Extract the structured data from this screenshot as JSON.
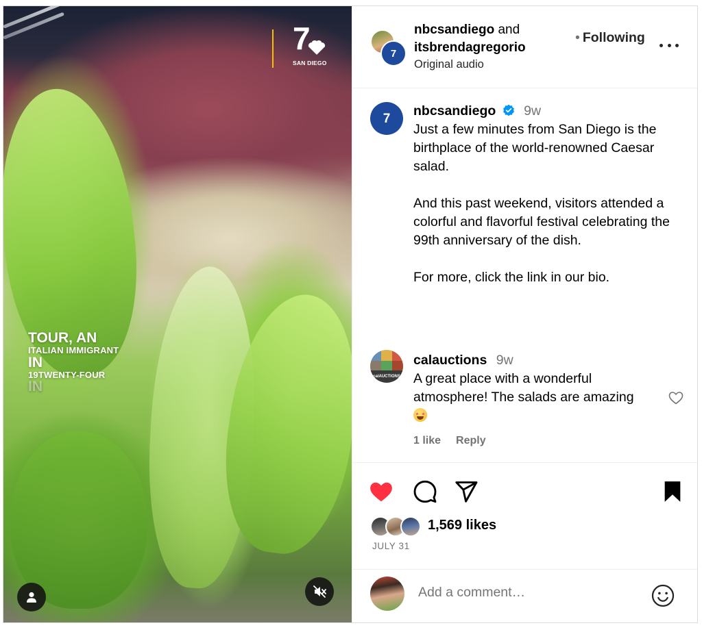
{
  "media": {
    "overlay_lines": [
      {
        "text": "TOUR, AN",
        "size": "big"
      },
      {
        "text": "ITALIAN IMMIGRANT",
        "size": "small"
      },
      {
        "text": "IN",
        "size": "big"
      },
      {
        "text": "19TWENTY-FOUR",
        "size": "small"
      },
      {
        "text": "IN",
        "size": "big",
        "faded": true
      }
    ],
    "logo_number": "7",
    "logo_city": "SAN DIEGO",
    "tag_icon": "person-icon",
    "mute_icon": "muted-speaker-icon"
  },
  "header": {
    "owner1": "nbcsandiego",
    "joiner": " and ",
    "owner2": "itsbrendagregorio",
    "audio": "Original audio",
    "follow_label": "Following",
    "more_icon": "more-options-icon"
  },
  "caption": {
    "user": "nbcsandiego",
    "time": "9w",
    "paragraphs": [
      "Just a few minutes from San Diego is the birthplace of the world-renowned Caesar salad.",
      "And this past weekend, visitors attended a colorful and flavorful festival celebrating the 99th anniversary of the dish.",
      "For more, click the link in our bio."
    ]
  },
  "comment": {
    "user": "calauctions",
    "time": "9w",
    "text": "A great place with a wonderful atmosphere! The salads are amazing",
    "emoji": "star-struck",
    "likes": "1 like",
    "reply_label": "Reply",
    "avatar_text": "calAUCTIONS"
  },
  "actions": {
    "likes": "1,569 likes",
    "date": "JULY 31",
    "liked": true,
    "saved": true
  },
  "composer": {
    "placeholder": "Add a comment…"
  },
  "colors": {
    "like_red": "#ff3040",
    "verified_blue": "#0095f6",
    "nbc_blue": "#1d4a9c",
    "secondary_text": "#737373"
  }
}
